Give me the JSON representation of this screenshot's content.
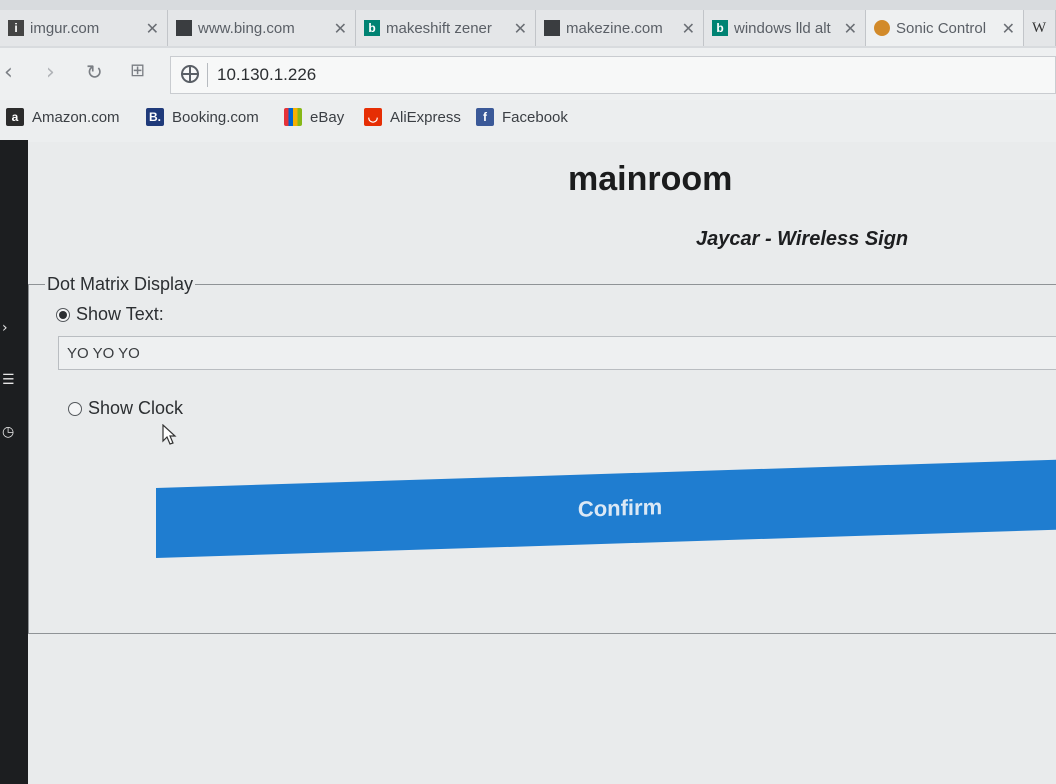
{
  "browser": {
    "tabs": [
      {
        "title": "imgur.com",
        "icon": "imgur-favicon"
      },
      {
        "title": "www.bing.com",
        "icon": "page-icon"
      },
      {
        "title": "makeshift zener",
        "icon": "bing-icon"
      },
      {
        "title": "makezine.com",
        "icon": "page-icon"
      },
      {
        "title": "windows lld alt",
        "icon": "bing-icon"
      },
      {
        "title": "Sonic Control",
        "icon": "sonic-icon"
      },
      {
        "title": "W",
        "icon": "wikipedia-icon"
      }
    ],
    "address": "10.130.1.226",
    "bookmarks": [
      {
        "label": "Amazon.com",
        "icon": "amazon-icon",
        "color": "#2b2b2b"
      },
      {
        "label": "Booking.com",
        "icon": "booking-icon",
        "color": "#1f3a7a"
      },
      {
        "label": "eBay",
        "icon": "ebay-icon",
        "color": "#e53238"
      },
      {
        "label": "AliExpress",
        "icon": "aliexpress-icon",
        "color": "#e62e04"
      },
      {
        "label": "Facebook",
        "icon": "facebook-icon",
        "color": "#3b5998"
      }
    ]
  },
  "page": {
    "title": "mainroom",
    "subtitle": "Jaycar - Wireless Sign",
    "fieldset_legend": "Dot Matrix Display",
    "show_text_label": "Show Text:",
    "show_text_value": "YO YO YO",
    "show_clock_label": "Show Clock",
    "selected_mode": "Show Text",
    "confirm_label": "Confirm"
  },
  "colors": {
    "confirm_bg": "#1f7dd0",
    "page_bg": "#e9ebec"
  }
}
